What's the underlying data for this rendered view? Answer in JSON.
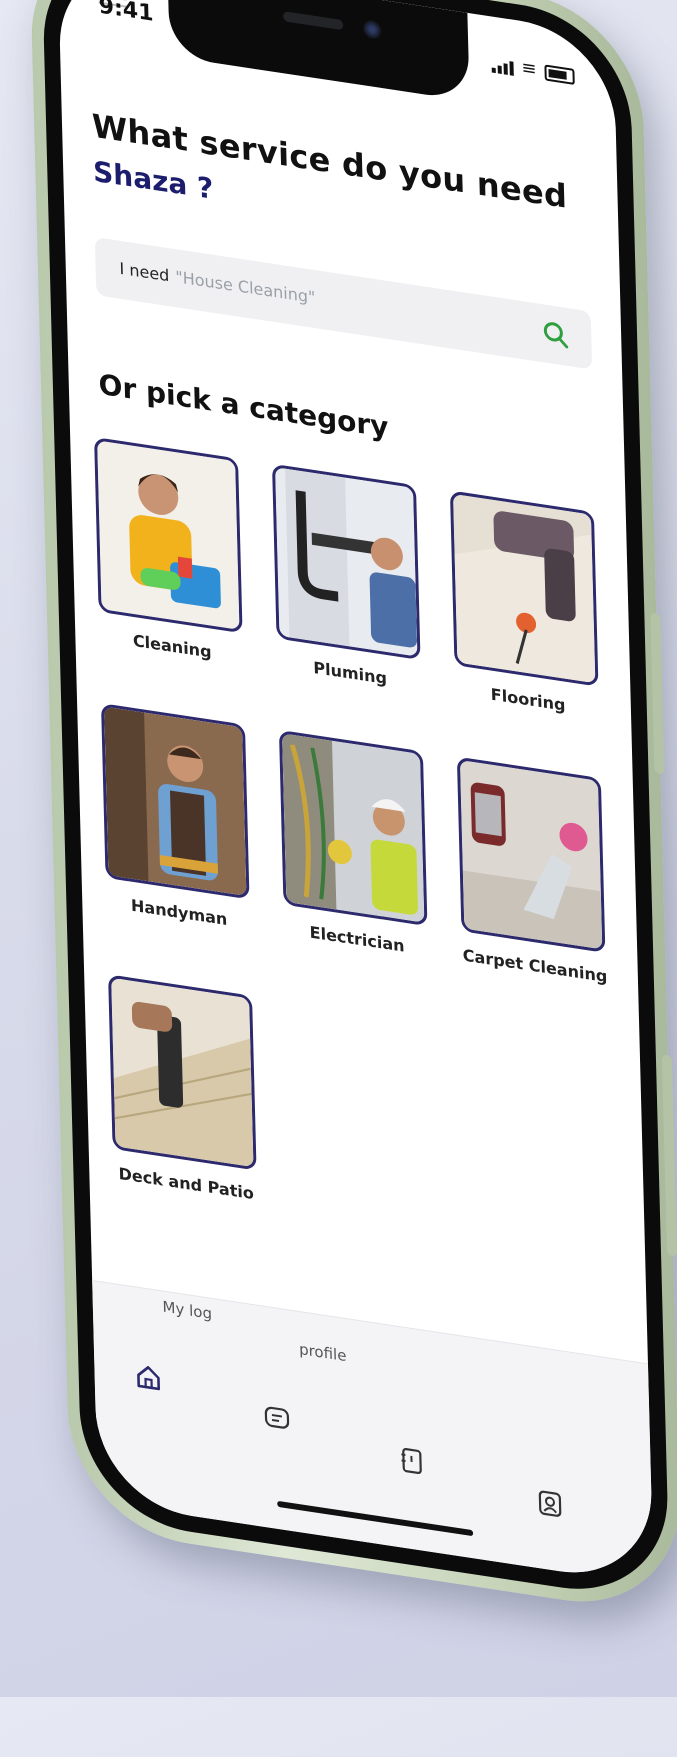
{
  "status_bar": {
    "time": "9:41"
  },
  "header": {
    "title": "What service do you need",
    "user_name": "Shaza ?"
  },
  "search": {
    "prefix": "I need",
    "placeholder": "\"House Cleaning\""
  },
  "section_title": "Or pick a category",
  "categories": [
    {
      "label": "Cleaning"
    },
    {
      "label": "Pluming"
    },
    {
      "label": "Flooring"
    },
    {
      "label": "Handyman"
    },
    {
      "label": "Electrician"
    },
    {
      "label": "Carpet Cleaning"
    },
    {
      "label": "Deck and Patio"
    }
  ],
  "tab_bar": {
    "ghost_labels": {
      "left": "My log",
      "center": "profile"
    }
  },
  "colors": {
    "accent": "#2c2a6d",
    "name": "#1d1d6e",
    "search_icon": "#2e9e3e"
  }
}
